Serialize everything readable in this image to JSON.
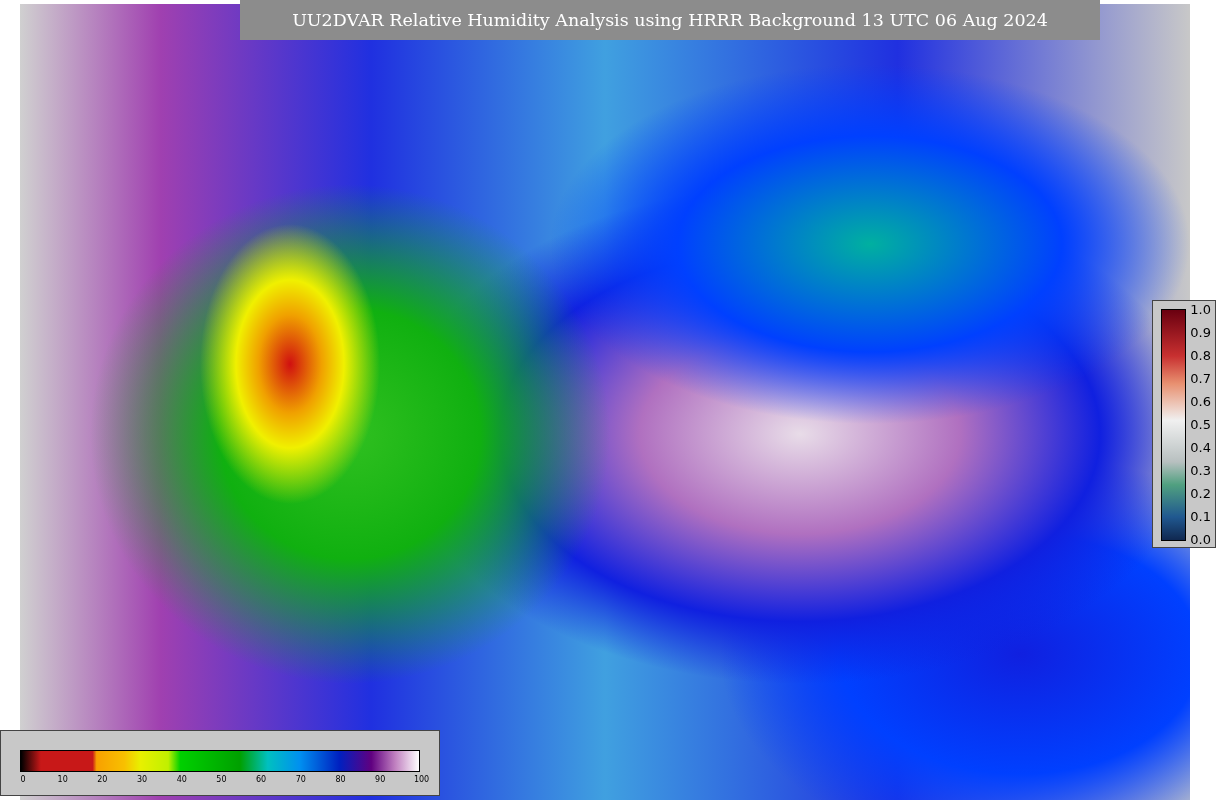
{
  "title": "UU2DVAR Relative Humidity Analysis using HRRR Background 13 UTC 06 Aug 2024",
  "right_colorbar": {
    "ticks": [
      "1.0",
      "0.9",
      "0.8",
      "0.7",
      "0.6",
      "0.5",
      "0.4",
      "0.3",
      "0.2",
      "0.1",
      "0.0"
    ]
  },
  "bottom_colorbar": {
    "ticks": [
      "0",
      "10",
      "20",
      "30",
      "40",
      "50",
      "60",
      "70",
      "80",
      "90",
      "100"
    ]
  }
}
